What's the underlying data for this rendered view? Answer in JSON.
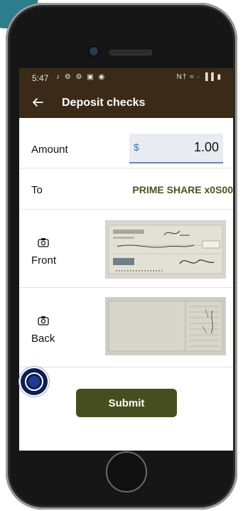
{
  "status_bar": {
    "time": "5:47",
    "left_icons": "♪ ⚙ ⚙ ▣ ◉",
    "right_icons": "N† ≈ · ▐▐ ▮"
  },
  "app_bar": {
    "title": "Deposit checks",
    "back_icon": "arrow-left-icon"
  },
  "form": {
    "amount_label": "Amount",
    "currency_symbol": "$",
    "amount_value": "1.00",
    "to_label": "To",
    "to_value": "PRIME SHARE x0S00",
    "front_label": "Front",
    "back_label": "Back",
    "camera_icon": "camera-icon",
    "submit_label": "Submit"
  },
  "colors": {
    "header_bg": "#3b2a18",
    "accent_olive": "#464e1f",
    "to_text": "#4e5221",
    "corner_teal": "#2d7d8c",
    "fab_navy": "#0d1e50"
  }
}
